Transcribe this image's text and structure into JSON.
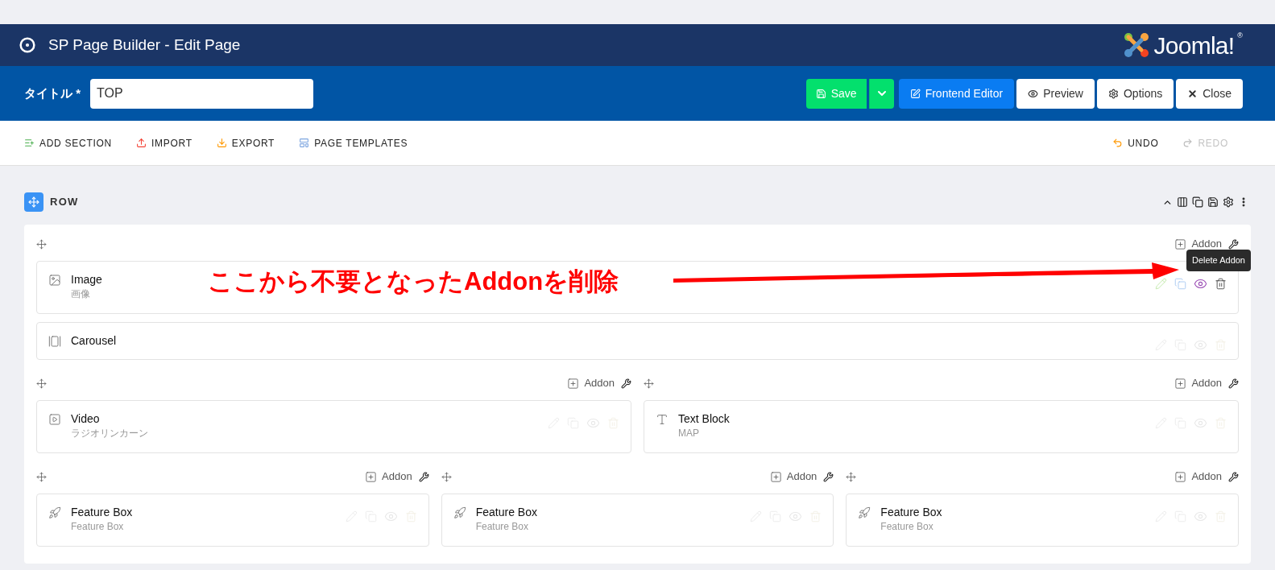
{
  "header": {
    "title": "SP Page Builder - Edit Page",
    "brand": "Joomla!",
    "brand_mark": "®"
  },
  "title_bar": {
    "label": "タイトル *",
    "value": "TOP",
    "buttons": [
      {
        "kind": "save",
        "label": "Save"
      },
      {
        "kind": "dropdown"
      },
      {
        "kind": "frontend",
        "label": "Frontend Editor"
      },
      {
        "kind": "preview",
        "label": "Preview"
      },
      {
        "kind": "options",
        "label": "Options"
      },
      {
        "kind": "close",
        "label": "Close"
      }
    ]
  },
  "toolbar": {
    "left": [
      {
        "kind": "add",
        "label": "ADD SECTION"
      },
      {
        "kind": "import",
        "label": "IMPORT"
      },
      {
        "kind": "export",
        "label": "EXPORT"
      },
      {
        "kind": "templates",
        "label": "PAGE TEMPLATES"
      }
    ],
    "right": [
      {
        "kind": "undo",
        "label": "UNDO",
        "disabled": false
      },
      {
        "kind": "redo",
        "label": "REDO",
        "disabled": true
      }
    ]
  },
  "row": {
    "label": "ROW",
    "sections": [
      {
        "columns": [
          {
            "addon_label": "Addon",
            "addons": [
              {
                "kind": "image",
                "title": "Image",
                "subtitle": "画像",
                "hovered": true
              },
              {
                "kind": "carousel",
                "title": "Carousel",
                "hovered": false
              }
            ]
          }
        ]
      },
      {
        "columns": [
          {
            "addon_label": "Addon",
            "addons": [
              {
                "kind": "video",
                "title": "Video",
                "subtitle": "ラジオリンカーン",
                "hovered": false
              }
            ]
          },
          {
            "addon_label": "Addon",
            "addons": [
              {
                "kind": "text",
                "title": "Text Block",
                "subtitle": "MAP",
                "hovered": false
              }
            ]
          }
        ]
      },
      {
        "columns": [
          {
            "addon_label": "Addon",
            "addons": [
              {
                "kind": "feature",
                "title": "Feature Box",
                "subtitle": "Feature Box",
                "hovered": false
              }
            ]
          },
          {
            "addon_label": "Addon",
            "addons": [
              {
                "kind": "feature",
                "title": "Feature Box",
                "subtitle": "Feature Box",
                "hovered": false
              }
            ]
          },
          {
            "addon_label": "Addon",
            "addons": [
              {
                "kind": "feature",
                "title": "Feature Box",
                "subtitle": "Feature Box",
                "hovered": false
              }
            ]
          }
        ]
      }
    ]
  },
  "tooltip": "Delete Addon",
  "annotation": "ここから不要となったAddonを削除"
}
